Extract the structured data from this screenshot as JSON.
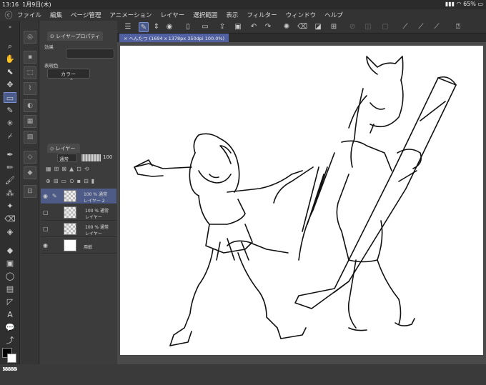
{
  "status": {
    "time": "13:16",
    "date": "1月9日(木)",
    "battery": "65%"
  },
  "menu": {
    "items": [
      "ファイル",
      "編集",
      "ページ管理",
      "アニメーション",
      "レイヤー",
      "選択範囲",
      "表示",
      "フィルター",
      "ウィンドウ",
      "ヘルプ"
    ]
  },
  "layer_property": {
    "tab_label": "レイヤープロパティ",
    "effect_label": "効果",
    "expression_label": "表現色",
    "color_mode": "カラー"
  },
  "layers": {
    "tab_label": "レイヤー",
    "blend_mode": "通常",
    "opacity": "100",
    "rows": [
      {
        "pct": "100 %",
        "mode": "通常",
        "name": "レイヤー 2"
      },
      {
        "pct": "100 %",
        "mode": "通常",
        "name": "レイヤー"
      },
      {
        "pct": "100 %",
        "mode": "通常",
        "name": "レイヤー"
      },
      {
        "pct": "",
        "mode": "",
        "name": "用紙"
      }
    ]
  },
  "document": {
    "title": "へんたつ (1694 x 1378px 350dpi 100.0%)"
  },
  "colors": {
    "accent": "#4a5a8a",
    "accent_border": "#7d93d6",
    "ui_bg": "#3a3a3a"
  }
}
